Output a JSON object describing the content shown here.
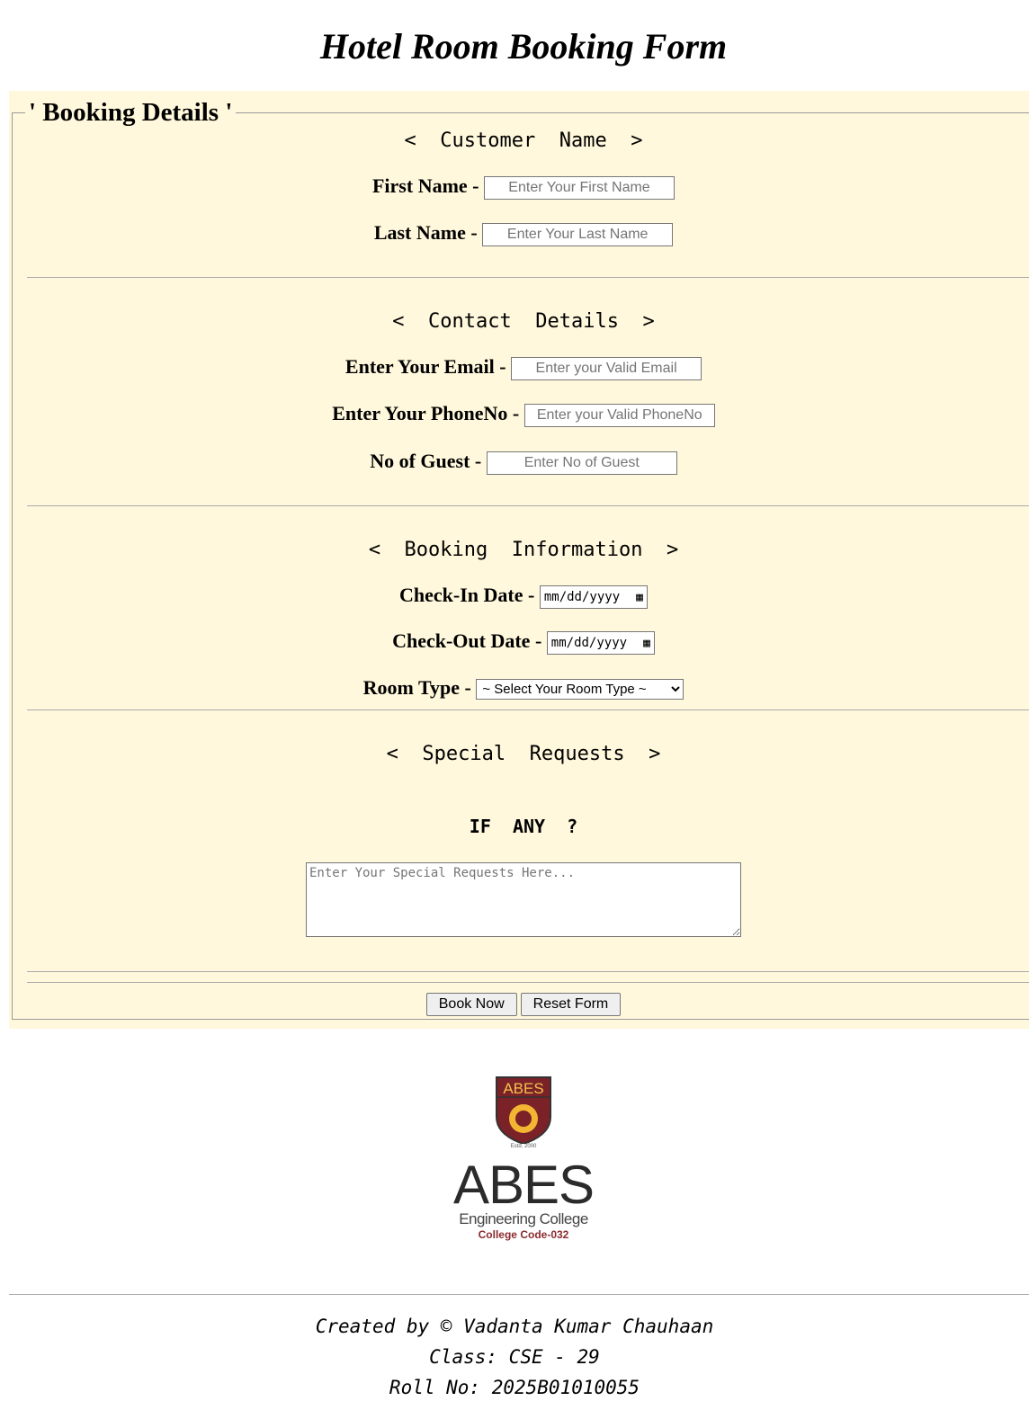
{
  "title": "Hotel Room Booking Form",
  "legend": "' Booking Details '",
  "sections": {
    "customer": "<  Customer  Name  >",
    "contact": "<  Contact  Details  >",
    "booking": "<  Booking  Information  >",
    "special": "<  Special  Requests  >"
  },
  "fields": {
    "first_name": {
      "label": "First Name -",
      "placeholder": "Enter Your First Name"
    },
    "last_name": {
      "label": "Last Name -",
      "placeholder": "Enter Your Last Name"
    },
    "email": {
      "label": "Enter Your Email -",
      "placeholder": "Enter your Valid Email"
    },
    "phone": {
      "label": "Enter Your PhoneNo -",
      "placeholder": "Enter your Valid PhoneNo"
    },
    "guests": {
      "label": "No of Guest -",
      "placeholder": "Enter No of Guest"
    },
    "checkin": {
      "label": "Check-In Date -",
      "value": "mm/dd/yyyy"
    },
    "checkout": {
      "label": "Check-Out Date -",
      "value": "mm/dd/yyyy"
    },
    "room_type": {
      "label": "Room Type -",
      "selected": "~ Select Your Room Type ~"
    }
  },
  "if_any": "IF  ANY  ?",
  "requests_placeholder": "Enter Your Special Requests Here...",
  "buttons": {
    "book": "Book Now",
    "reset": "Reset Form"
  },
  "logo": {
    "shield_text": "ABES",
    "estd": "Estd. 2000",
    "name": "ABES",
    "sub": "Engineering College",
    "code": "College Code-032"
  },
  "footer": {
    "created": "Created by © Vadanta Kumar Chauhaan",
    "class": "Class: CSE - 29",
    "roll": "Roll No: 2025B01010055"
  }
}
